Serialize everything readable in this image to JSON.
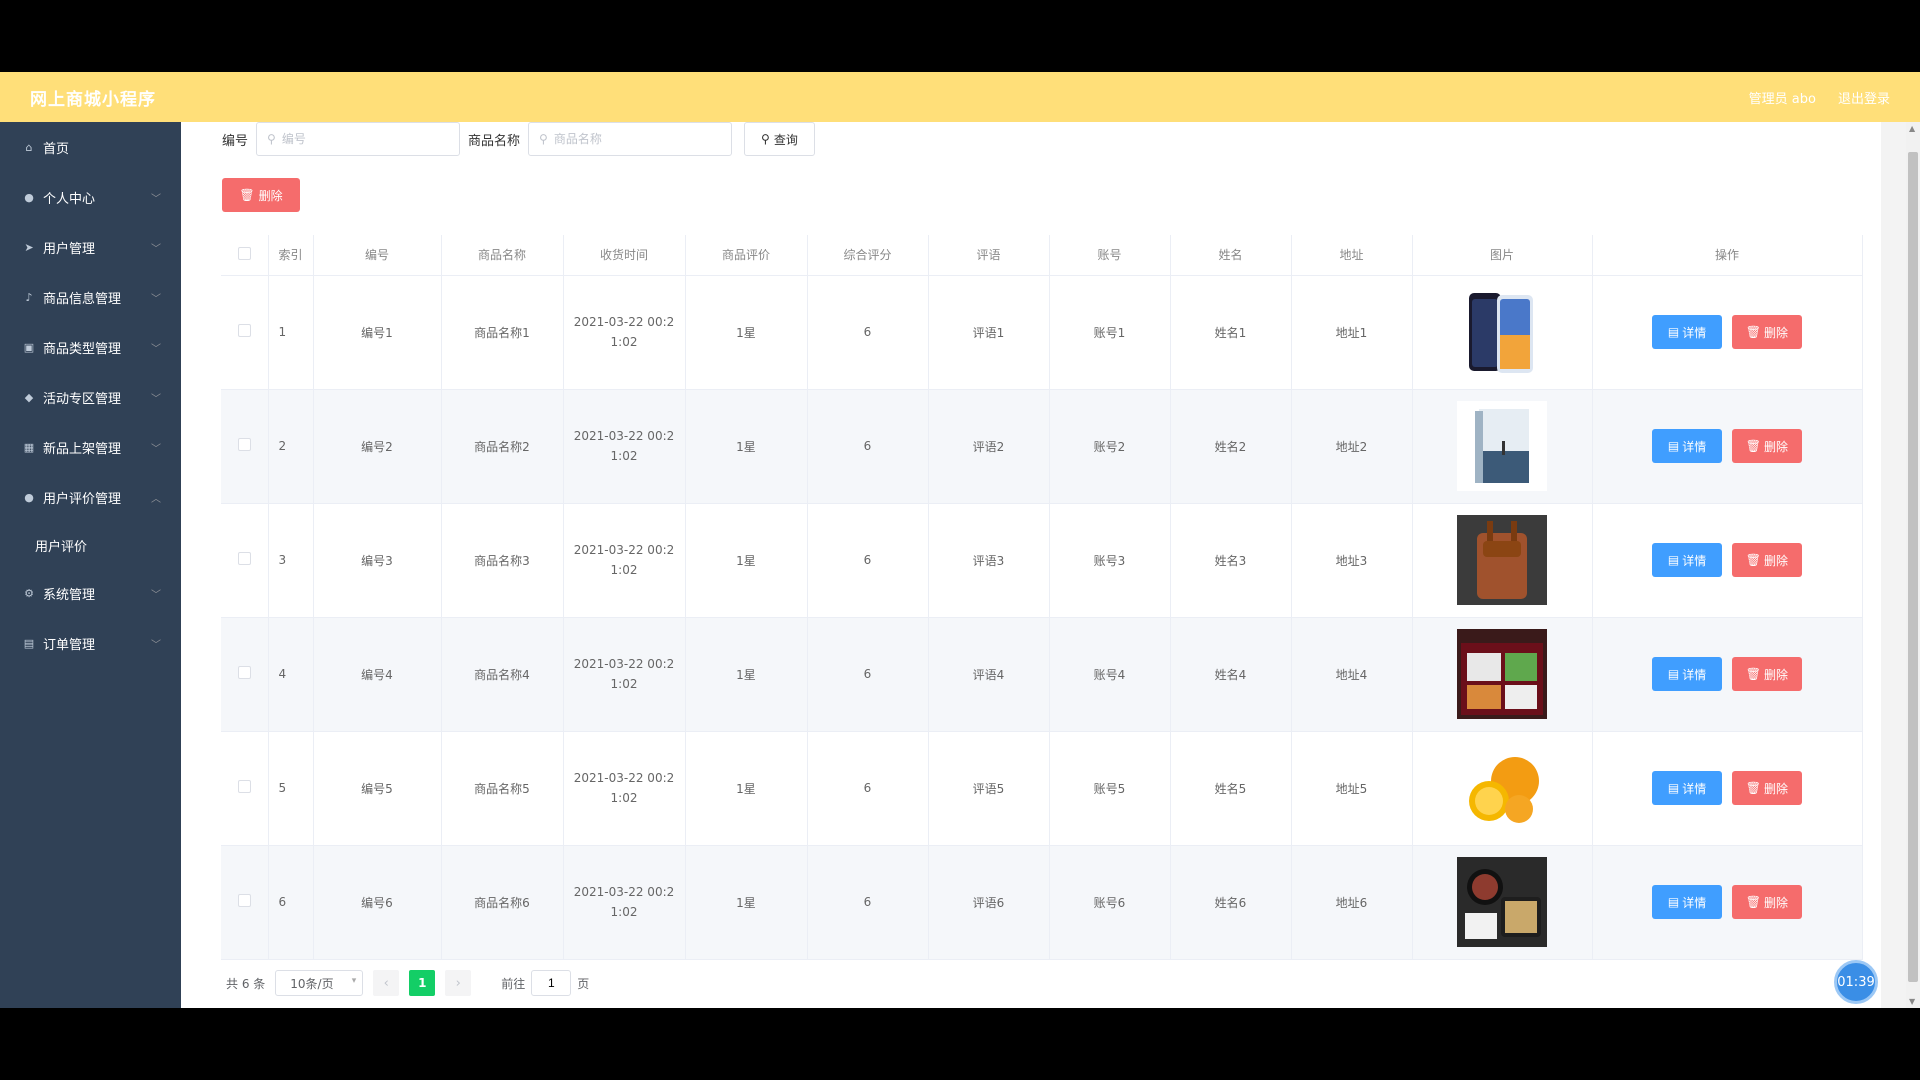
{
  "header": {
    "title": "网上商城小程序",
    "admin_label": "管理员 abo",
    "logout_label": "退出登录"
  },
  "sidebar": {
    "items": [
      {
        "label": "首页",
        "icon": "home-icon"
      },
      {
        "label": "个人中心",
        "icon": "user-icon"
      },
      {
        "label": "用户管理",
        "icon": "send-icon"
      },
      {
        "label": "商品信息管理",
        "icon": "mic-icon"
      },
      {
        "label": "商品类型管理",
        "icon": "box-icon"
      },
      {
        "label": "活动专区管理",
        "icon": "pin-icon"
      },
      {
        "label": "新品上架管理",
        "icon": "grid-icon"
      },
      {
        "label": "用户评价管理",
        "icon": "user-icon"
      },
      {
        "label": "系统管理",
        "icon": "settings-icon"
      },
      {
        "label": "订单管理",
        "icon": "doc-icon"
      }
    ],
    "submenu_label": "用户评价"
  },
  "search": {
    "id_label": "编号",
    "id_placeholder": "编号",
    "name_label": "商品名称",
    "name_placeholder": "商品名称",
    "query_label": "查询"
  },
  "toolbar": {
    "delete_label": "删除"
  },
  "table": {
    "headers": [
      "索引",
      "编号",
      "商品名称",
      "收货时间",
      "商品评价",
      "综合评分",
      "评语",
      "账号",
      "姓名",
      "地址",
      "图片",
      "操作"
    ],
    "rows": [
      {
        "idx": "1",
        "code": "编号1",
        "name": "商品名称1",
        "time": "2021-03-22 00:2\n1:02",
        "rating": "1星",
        "score": "6",
        "comment": "评语1",
        "account": "账号1",
        "person": "姓名1",
        "addr": "地址1",
        "img": "phone"
      },
      {
        "idx": "2",
        "code": "编号2",
        "name": "商品名称2",
        "time": "2021-03-22 00:2\n1:02",
        "rating": "1星",
        "score": "6",
        "comment": "评语2",
        "account": "账号2",
        "person": "姓名2",
        "addr": "地址2",
        "img": "book"
      },
      {
        "idx": "3",
        "code": "编号3",
        "name": "商品名称3",
        "time": "2021-03-22 00:2\n1:02",
        "rating": "1星",
        "score": "6",
        "comment": "评语3",
        "account": "账号3",
        "person": "姓名3",
        "addr": "地址3",
        "img": "bag"
      },
      {
        "idx": "4",
        "code": "编号4",
        "name": "商品名称4",
        "time": "2021-03-22 00:2\n1:02",
        "rating": "1星",
        "score": "6",
        "comment": "评语4",
        "account": "账号4",
        "person": "姓名4",
        "addr": "地址4",
        "img": "food"
      },
      {
        "idx": "5",
        "code": "编号5",
        "name": "商品名称5",
        "time": "2021-03-22 00:2\n1:02",
        "rating": "1星",
        "score": "6",
        "comment": "评语5",
        "account": "账号5",
        "person": "姓名5",
        "addr": "地址5",
        "img": "orange"
      },
      {
        "idx": "6",
        "code": "编号6",
        "name": "商品名称6",
        "time": "2021-03-22 00:2\n1:02",
        "rating": "1星",
        "score": "6",
        "comment": "评语6",
        "account": "账号6",
        "person": "姓名6",
        "addr": "地址6",
        "img": "meal"
      }
    ],
    "detail_label": "详情",
    "delete_label": "删除"
  },
  "pagination": {
    "total": "共 6 条",
    "page_size": "10条/页",
    "current": "1",
    "goto_prefix": "前往",
    "goto_value": "1",
    "goto_suffix": "页"
  },
  "timer": "01:39",
  "colors": {
    "header": "#ffdf79",
    "sidebar": "#304156",
    "primary": "#409eff",
    "danger": "#f56c6c",
    "pager_active": "#13ce66"
  }
}
